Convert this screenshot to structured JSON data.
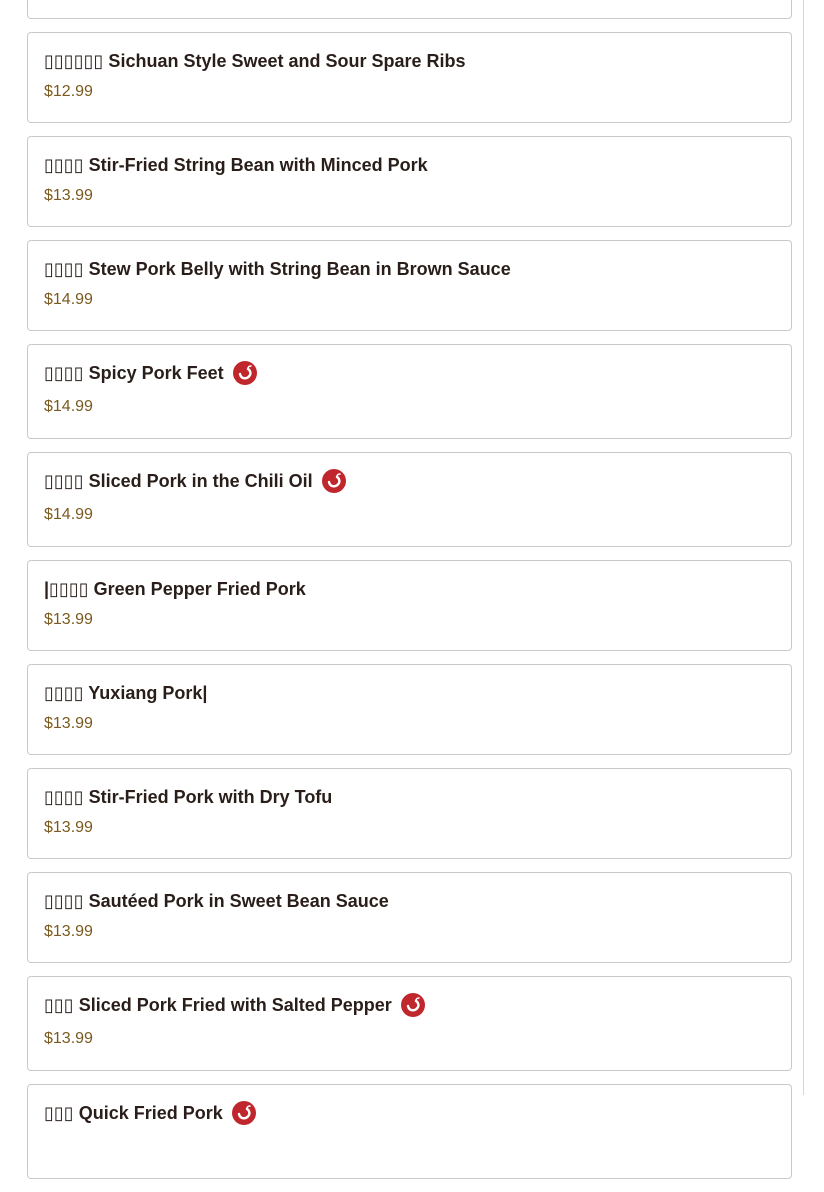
{
  "items": [
    {
      "name": "",
      "price": "",
      "spicy": false
    },
    {
      "name": "▯▯▯▯▯▯ Sichuan Style Sweet and Sour Spare Ribs",
      "price": "$12.99",
      "spicy": false
    },
    {
      "name": "▯▯▯▯ Stir-Fried String Bean with Minced Pork",
      "price": "$13.99",
      "spicy": false
    },
    {
      "name": "▯▯▯▯ Stew Pork Belly with String Bean in Brown Sauce",
      "price": "$14.99",
      "spicy": false
    },
    {
      "name": "▯▯▯▯ Spicy Pork Feet",
      "price": "$14.99",
      "spicy": true
    },
    {
      "name": "▯▯▯▯ Sliced Pork in the Chili Oil",
      "price": "$14.99",
      "spicy": true
    },
    {
      "name": "|▯▯▯▯ Green Pepper Fried Pork",
      "price": "$13.99",
      "spicy": false
    },
    {
      "name": "▯▯▯▯ Yuxiang Pork|",
      "price": "$13.99",
      "spicy": false
    },
    {
      "name": "▯▯▯▯ Stir-Fried Pork with Dry Tofu",
      "price": "$13.99",
      "spicy": false
    },
    {
      "name": "▯▯▯▯ Sautéed Pork in Sweet Bean Sauce",
      "price": "$13.99",
      "spicy": false
    },
    {
      "name": "▯▯▯ Sliced Pork Fried with Salted Pepper",
      "price": "$13.99",
      "spicy": true
    },
    {
      "name": "▯▯▯ Quick Fried Pork",
      "price": "",
      "spicy": true
    }
  ],
  "colors": {
    "accent": "#c0272d",
    "price": "#7a5a1e",
    "title": "#2a1e1a",
    "border": "#c9c9c9"
  },
  "icons": {
    "spicy": "chili-pepper-icon"
  }
}
